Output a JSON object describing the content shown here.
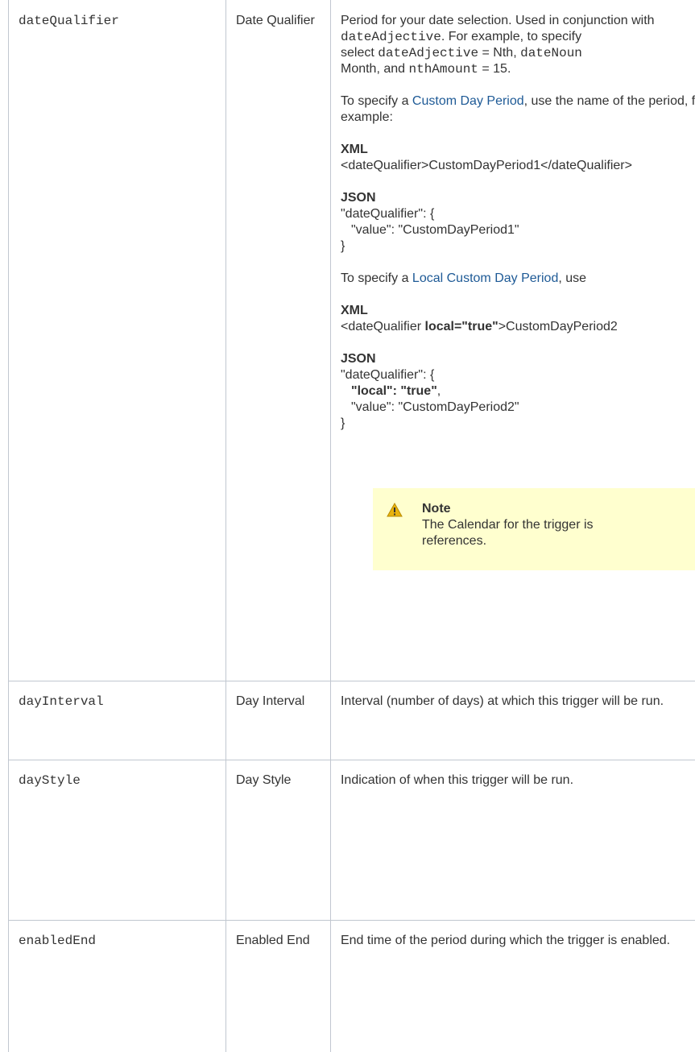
{
  "rows": [
    {
      "name": "dateQualifier",
      "label": [
        "Date",
        "Qualifier"
      ],
      "description": {
        "intro": {
          "l1": "Period for your date selection. Used in conjunction with",
          "l2a": "dateAdjective",
          "l2b": ". For example, to specify",
          "l3a": "select ",
          "l3b": "dateAdjective",
          "l3c": " = Nth, ",
          "l3d": "dateNoun",
          "l4a": "Month, and ",
          "l4b": "nthAmount",
          "l4c": " = 15."
        },
        "custom": {
          "pre": "To specify a ",
          "link": "Custom Day Period",
          "post": ", use the name of the period, for",
          "l2": "example:"
        },
        "xml1": {
          "heading": "XML",
          "code": "<dateQualifier>CustomDayPeriod1</dateQualifier>"
        },
        "json1": {
          "heading": "JSON",
          "l1": "\"dateQualifier\": {",
          "l2": "\"value\": \"CustomDayPeriod1\"",
          "l3": "}"
        },
        "local": {
          "pre": "To specify a ",
          "link": "Local Custom Day Period",
          "post": ", use"
        },
        "xml2": {
          "heading": "XML",
          "a": "<dateQualifier ",
          "b": "local=\"true\"",
          "c": ">CustomDayPeriod2"
        },
        "json2": {
          "heading": "JSON",
          "l1": "\"dateQualifier\": {",
          "l2": "\"local\": \"true\"",
          "l2tail": ",",
          "l3": "\"value\": \"CustomDayPeriod2\"",
          "l4": "}"
        },
        "note": {
          "title": "Note",
          "l1": "The Calendar for the trigger is",
          "l2": "references."
        }
      }
    },
    {
      "name": "dayInterval",
      "label": [
        "Day",
        "Interval"
      ],
      "description": "Interval (number of days) at which this trigger will be run."
    },
    {
      "name": "dayStyle",
      "label": [
        "Day Style"
      ],
      "description": "Indication of when this trigger will be run."
    },
    {
      "name": "enabledEnd",
      "label": [
        "Enabled",
        "End"
      ],
      "description": "End time of the period during which the trigger is enabled."
    }
  ],
  "colors": {
    "border": "#c1c7d0",
    "link": "#1e5a96",
    "note_bg": "#ffffcf",
    "warning_icon": "#e8b20e"
  },
  "icons": {
    "note": "warning-icon"
  }
}
